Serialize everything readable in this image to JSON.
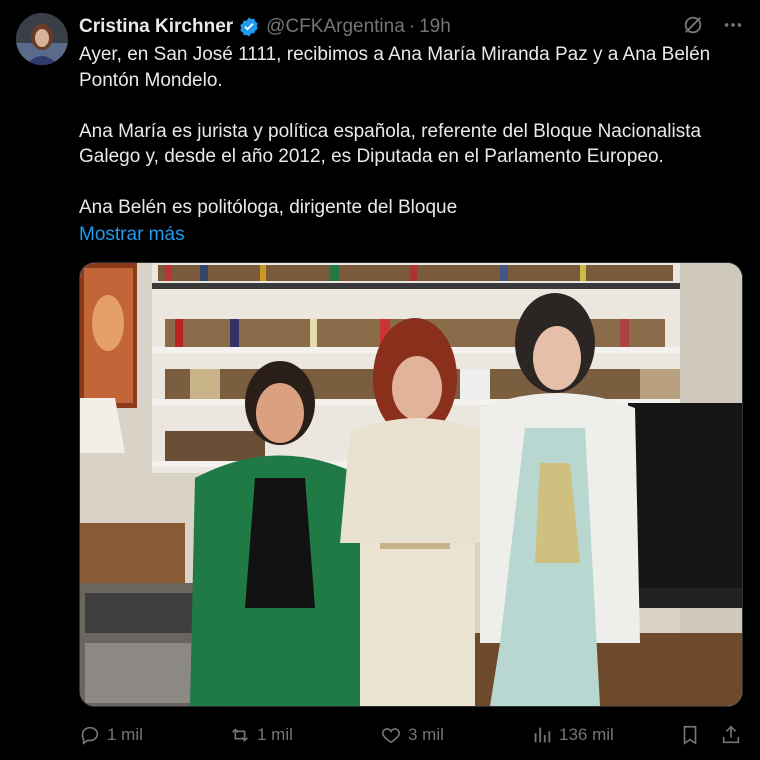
{
  "tweet": {
    "author_name": "Cristina Kirchner",
    "handle": "@CFKArgentina",
    "separator": "·",
    "time": "19h",
    "paragraphs": [
      "Ayer, en San José 1111, recibimos a Ana María Miranda Paz y a Ana Belén Pontón Mondelo.",
      "Ana María es jurista y política española, referente del Bloque Nacionalista Galego y, desde el año 2012, es Diputada en el Parlamento Europeo.",
      "Ana Belén es politóloga, dirigente del Bloque"
    ],
    "show_more": "Mostrar más"
  },
  "actions": {
    "replies": "1 mil",
    "reposts": "1 mil",
    "likes": "3 mil",
    "views": "136 mil"
  },
  "icons": {
    "verified": "verified-badge-icon",
    "grok": "grok-icon",
    "more": "more-icon",
    "reply": "reply-icon",
    "repost": "repost-icon",
    "like": "heart-icon",
    "views": "views-icon",
    "bookmark": "bookmark-icon",
    "share": "share-icon"
  },
  "colors": {
    "background": "#000000",
    "text": "#e7e9ea",
    "secondary": "#71767b",
    "link": "#1d9bf0",
    "verified": "#1d9bf0"
  }
}
